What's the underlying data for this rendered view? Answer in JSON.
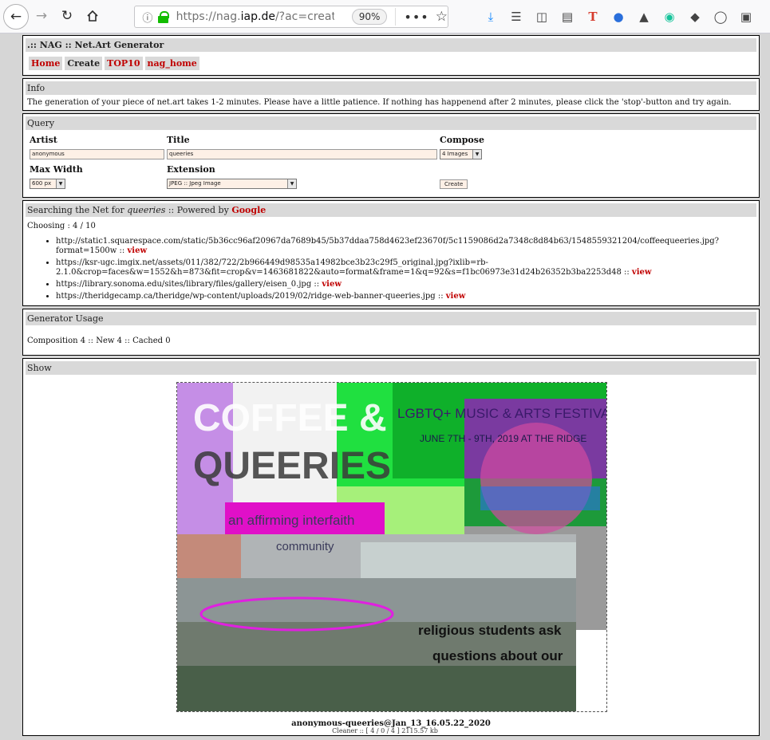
{
  "browser": {
    "url_prefix": "https://nag.",
    "url_domain": "iap.de",
    "url_suffix": "/?ac=create",
    "zoom": "90%"
  },
  "header": {
    "title": ".:: NAG :: Net.Art Generator",
    "nav": [
      "Home",
      "Create",
      "TOP10",
      "nag_home"
    ]
  },
  "info": {
    "title": "Info",
    "text": "The generation of your piece of net.art takes 1-2 minutes. Please have a little patience. If nothing has happenend after 2 minutes, please click the 'stop'-button and try again."
  },
  "query": {
    "title": "Query",
    "artist_label": "Artist",
    "artist_value": "anonymous",
    "title_label": "Title",
    "title_value": "queeries",
    "compose_label": "Compose",
    "compose_value": "4 Images",
    "maxwidth_label": "Max Width",
    "maxwidth_value": "600 px",
    "extension_label": "Extension",
    "extension_value": "JPEG :: Jpeg Image",
    "create_label": "Create"
  },
  "search": {
    "prefix": "Searching the Net for ",
    "term": "queeries",
    "powered": " :: Powered by ",
    "engine": "Google",
    "choosing": "Choosing : 4 / 10",
    "view_label": "view",
    "results": [
      "http://static1.squarespace.com/static/5b36cc96af20967da7689b45/5b37ddaa758d4623ef23670f/5c1159086d2a7348c8d84b63/1548559321204/coffeequeeries.jpg?format=1500w ::",
      "https://ksr-ugc.imgix.net/assets/011/382/722/2b966449d98535a14982bce3b23c29f5_original.jpg?ixlib=rb-2.1.0&crop=faces&w=1552&h=873&fit=crop&v=1463681822&auto=format&frame=1&q=92&s=f1bc06973e31d24b26352b3ba2253d48 ::",
      "https://library.sonoma.edu/sites/library/files/gallery/eisen_0.jpg ::",
      "https://theridgecamp.ca/theridge/wp-content/uploads/2019/02/ridge-web-banner-queeries.jpg ::"
    ]
  },
  "usage": {
    "title": "Generator Usage",
    "text": "Composition 4 :: New 4 :: Cached 0"
  },
  "show": {
    "title": "Show",
    "art_text": {
      "coffee": "COFFEE &",
      "queeries": "QUEERIES",
      "festival": "LGBTQ+ MUSIC & ARTS FESTIVAL",
      "date": "JUNE 7TH - 9TH, 2019 AT THE RIDGE",
      "affirming": "an affirming interfaith",
      "community": "community",
      "ask": "religious students ask",
      "questions": "questions about our"
    },
    "caption": "anonymous-queeries@Jan_13_16.05.22_2020"
  },
  "footer": "Cleaner :: [ 4 / 0 / 4 ] 2115.57 kb"
}
